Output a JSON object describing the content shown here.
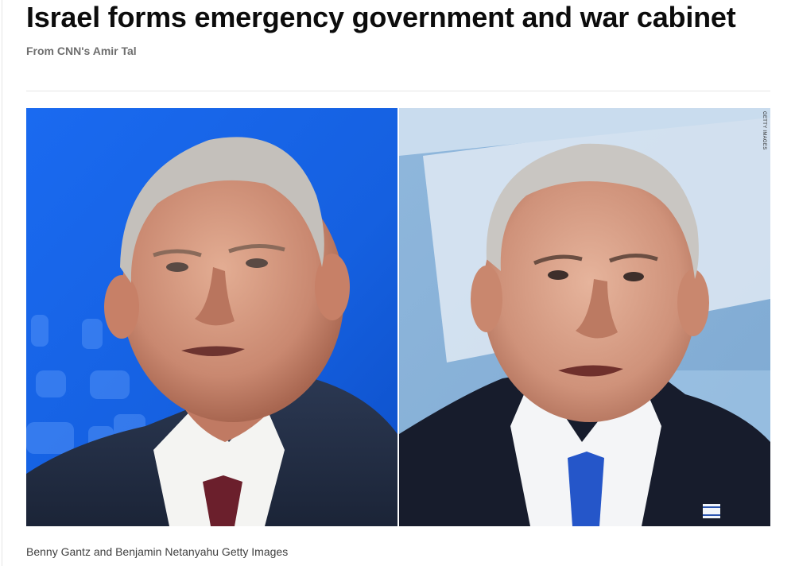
{
  "article": {
    "headline": "Israel forms emergency government and war cabinet",
    "byline": "From CNN's Amir Tal",
    "photo_credit_overlay": "GETTY IMAGES",
    "caption": "Benny Gantz and Benjamin Netanyahu Getty Images"
  },
  "colors": {
    "left_background": "#1565e8",
    "right_background": "#9cc3e6",
    "headline_text": "#0c0c0c",
    "byline_text": "#6e6e6e",
    "caption_text": "#404040"
  }
}
